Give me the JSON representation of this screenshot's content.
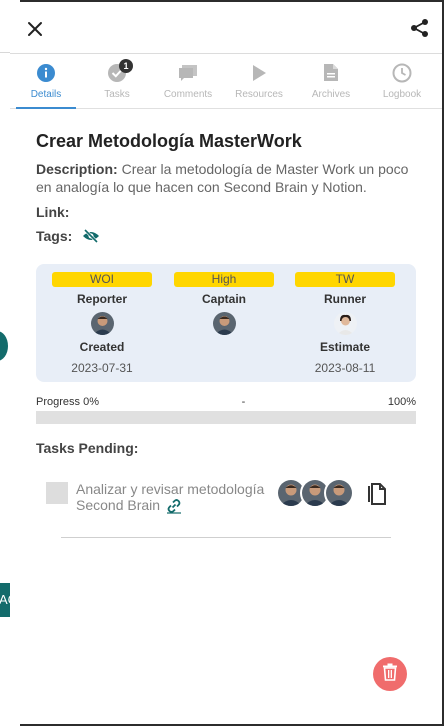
{
  "tabs": [
    {
      "label": "Details",
      "icon": "info-icon"
    },
    {
      "label": "Tasks",
      "icon": "check-circle-icon",
      "badge": "1"
    },
    {
      "label": "Comments",
      "icon": "comments-icon"
    },
    {
      "label": "Resources",
      "icon": "play-icon"
    },
    {
      "label": "Archives",
      "icon": "file-icon"
    },
    {
      "label": "Logbook",
      "icon": "clock-icon"
    }
  ],
  "project": {
    "title": "Crear Metodología MasterWork",
    "description_label": "Description:",
    "description": "Crear la metodología de Master Work un poco en analogía lo que hacen con Second Brain y Notion.",
    "link_label": "Link:",
    "tags_label": "Tags:"
  },
  "card": {
    "col1": {
      "pill": "WOI",
      "role": "Reporter",
      "sub": "Created",
      "date": "2023-07-31"
    },
    "col2": {
      "pill": "High",
      "role": "Captain"
    },
    "col3": {
      "pill": "TW",
      "role": "Runner",
      "sub": "Estimate",
      "date": "2023-08-11"
    }
  },
  "progress": {
    "left": "Progress 0%",
    "mid": "-",
    "right": "100%",
    "value": 0
  },
  "tasks": {
    "title": "Tasks Pending:",
    "items": [
      {
        "text": "Analizar y revisar metodología Second Brain"
      }
    ]
  },
  "colors": {
    "accent": "#3b8bd0",
    "pill": "#ffd600",
    "card_bg": "#e8eef7",
    "delete": "#f06c6c",
    "teal": "#136b6b"
  }
}
